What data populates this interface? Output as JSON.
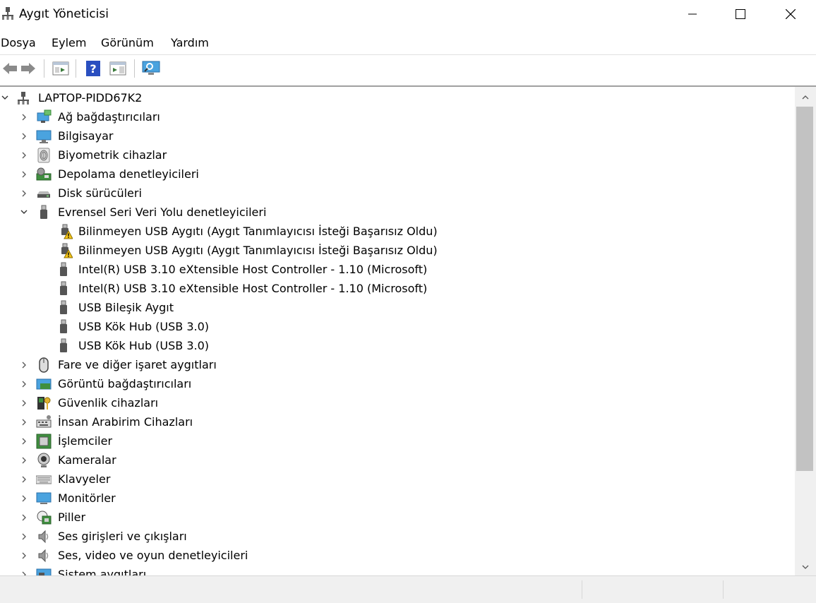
{
  "window": {
    "title": "Aygıt Yöneticisi"
  },
  "menu": [
    {
      "label": "Dosya"
    },
    {
      "label": "Eylem"
    },
    {
      "label": "Görünüm"
    },
    {
      "label": "Yardım"
    }
  ],
  "toolbar": {
    "buttons": [
      "back-icon",
      "forward-icon",
      "properties-icon",
      "help-icon",
      "action-pane-icon",
      "scan-hardware-icon"
    ]
  },
  "tree": {
    "root": "LAPTOP-PIDD67K2",
    "categories": [
      {
        "label": "Ağ bağdaştırıcıları",
        "icon": "network-adapter-icon"
      },
      {
        "label": "Bilgisayar",
        "icon": "computer-icon"
      },
      {
        "label": "Biyometrik cihazlar",
        "icon": "fingerprint-icon"
      },
      {
        "label": "Depolama denetleyicileri",
        "icon": "storage-controller-icon"
      },
      {
        "label": "Disk sürücüleri",
        "icon": "disk-drive-icon"
      },
      {
        "label": "Evrensel Seri Veri Yolu denetleyicileri",
        "icon": "usb-icon",
        "expanded": true
      },
      {
        "label": "Fare ve diğer işaret aygıtları",
        "icon": "mouse-icon"
      },
      {
        "label": "Görüntü bağdaştırıcıları",
        "icon": "display-adapter-icon"
      },
      {
        "label": "Güvenlik cihazları",
        "icon": "security-device-icon"
      },
      {
        "label": "İnsan Arabirim Cihazları",
        "icon": "hid-icon"
      },
      {
        "label": "İşlemciler",
        "icon": "processor-icon"
      },
      {
        "label": "Kameralar",
        "icon": "camera-icon"
      },
      {
        "label": "Klavyeler",
        "icon": "keyboard-icon"
      },
      {
        "label": "Monitörler",
        "icon": "monitor-icon"
      },
      {
        "label": "Piller",
        "icon": "battery-icon"
      },
      {
        "label": "Ses girişleri ve çıkışları",
        "icon": "speaker-icon"
      },
      {
        "label": "Ses, video ve oyun denetleyicileri",
        "icon": "speaker-icon"
      },
      {
        "label": "Sistem aygıtları",
        "icon": "system-device-icon"
      }
    ],
    "usb_children": [
      {
        "label": "Bilinmeyen USB Aygıtı (Aygıt Tanımlayıcısı İsteği Başarısız Oldu)",
        "icon": "warning-usb-icon"
      },
      {
        "label": "Bilinmeyen USB Aygıtı (Aygıt Tanımlayıcısı İsteği Başarısız Oldu)",
        "icon": "warning-usb-icon"
      },
      {
        "label": "Intel(R) USB 3.10 eXtensible Host Controller - 1.10 (Microsoft)",
        "icon": "usb-icon"
      },
      {
        "label": "Intel(R) USB 3.10 eXtensible Host Controller - 1.10 (Microsoft)",
        "icon": "usb-icon"
      },
      {
        "label": "USB Bileşik Aygıt",
        "icon": "usb-icon"
      },
      {
        "label": "USB Kök Hub (USB 3.0)",
        "icon": "usb-icon"
      },
      {
        "label": "USB Kök Hub (USB 3.0)",
        "icon": "usb-icon"
      }
    ]
  },
  "colors": {
    "accent": "#1e88e5",
    "warning": "#f5c518",
    "statusbar": "#f0f0f0"
  }
}
